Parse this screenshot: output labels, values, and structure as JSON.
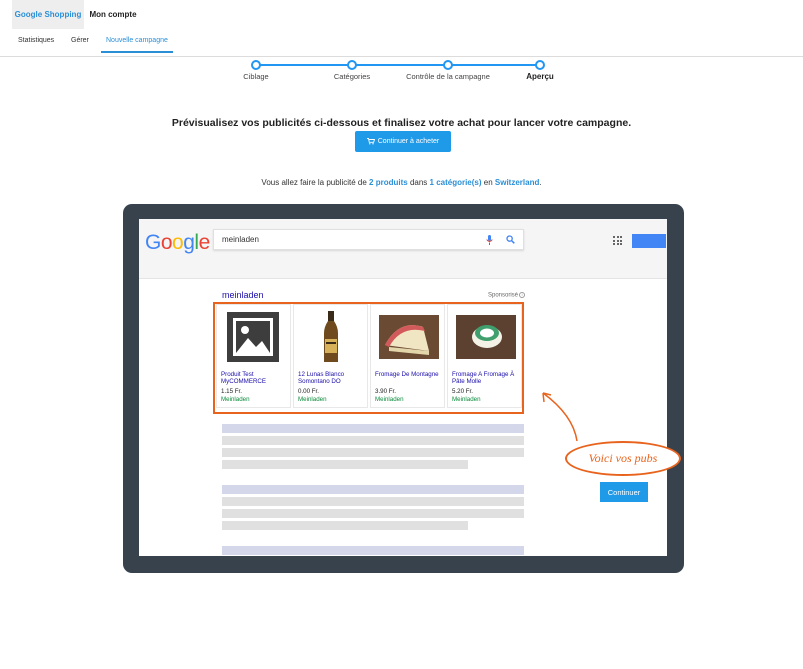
{
  "topbar": {
    "tabs": [
      {
        "label": "Google Shopping",
        "active": true
      },
      {
        "label": "Mon compte",
        "active": false
      }
    ]
  },
  "subnav": {
    "items": [
      {
        "label": "Statistiques",
        "active": false
      },
      {
        "label": "Gérer",
        "active": false
      },
      {
        "label": "Nouvelle campagne",
        "active": true
      }
    ]
  },
  "stepper": {
    "steps": [
      {
        "label": "Ciblage"
      },
      {
        "label": "Catégories"
      },
      {
        "label": "Contrôle de la campagne"
      },
      {
        "label": "Aperçu",
        "current": true
      }
    ]
  },
  "headline": "Prévisualisez vos publicités ci-dessous et finalisez votre achat pour lancer votre campagne.",
  "buy_button": {
    "label": "Continuer à acheter",
    "icon": "cart-icon"
  },
  "summary": {
    "prefix": "Vous allez faire la publicité de ",
    "products": "2 produits",
    "middle": " dans ",
    "categories": "1 catégorie(s)",
    "middle2": " en ",
    "country": "Switzerland",
    "suffix": "."
  },
  "preview": {
    "logo": "Google",
    "search_query": "meinladen",
    "results_title": "meinladen",
    "sponsored_label": "Sponsorisé",
    "products": [
      {
        "name": "Produit Test MyCOMMERCE",
        "price": "1.15 Fr.",
        "store": "Meinladen",
        "image": "placeholder-image-icon"
      },
      {
        "name": "12 Lunas Blanco Somontano DO",
        "price": "0.00 Fr.",
        "store": "Meinladen",
        "image": "wine-bottle-image"
      },
      {
        "name": "Fromage De Montagne",
        "price": "3.90 Fr.",
        "store": "Meinladen",
        "image": "cheese-wedge-image"
      },
      {
        "name": "Fromage A Fromage À Pâte Molle",
        "price": "5.20 Fr.",
        "store": "Meinladen",
        "image": "soft-cheese-image"
      }
    ]
  },
  "callout": "Voici vos pubs",
  "continue_button": "Continuer",
  "colors": {
    "accent": "#1e9ae8",
    "highlight": "#e8641e",
    "device_frame": "#37424d",
    "link": "#1a0dab",
    "store": "#0a8a3a"
  }
}
